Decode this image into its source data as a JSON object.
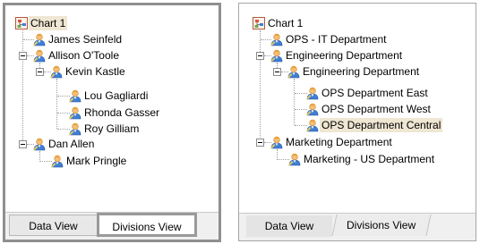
{
  "left_panel": {
    "root": "Chart 1",
    "nodes": {
      "james": "James Seinfeld",
      "allison": "Allison O'Toole",
      "kevin": "Kevin Kastle",
      "lou": "Lou Gagliardi",
      "rhonda": "Rhonda Gasser",
      "roy": "Roy Gilliam",
      "dan": "Dan Allen",
      "mark": "Mark Pringle"
    },
    "tabs": {
      "data_view": "Data View",
      "divisions_view": "Divisions View",
      "active": "Divisions View"
    },
    "selected": "Chart 1"
  },
  "right_panel": {
    "root": "Chart 1",
    "nodes": {
      "ops_it": "OPS - IT Department",
      "engineering": "Engineering Department",
      "engineering_sub": "Engineering Department",
      "ops_east": "OPS Department East",
      "ops_west": "OPS Department West",
      "ops_central": "OPS Department Central",
      "marketing": "Marketing Department",
      "marketing_us": "Marketing - US Department"
    },
    "tabs": {
      "data_view": "Data View",
      "divisions_view": "Divisions View",
      "active": "Divisions View"
    },
    "selected": "OPS Department Central"
  },
  "colors": {
    "selection": "#efe6d3",
    "person_head": "#e9a23b",
    "person_body": "#3f7fd6",
    "chart_icon_border": "#b05a3c"
  },
  "icons": {
    "root": "chart-icon",
    "node": "person-icon",
    "expander": "minus-box-icon"
  }
}
